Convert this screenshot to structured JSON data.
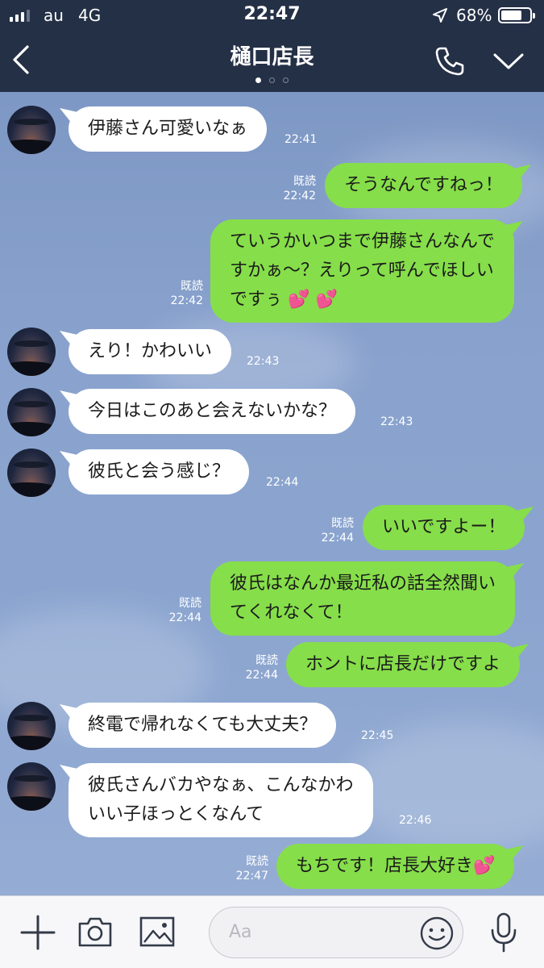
{
  "status_bar": {
    "carrier": "au",
    "network": "4G",
    "time": "22:47",
    "battery_percent": "68%",
    "battery_level": 0.68,
    "signal_bars": 3
  },
  "header": {
    "title": "樋口店長",
    "page_count": 3,
    "active_page": 1,
    "icons": [
      "back-chevron-icon",
      "phone-icon",
      "chevron-down-icon"
    ]
  },
  "messages": [
    {
      "side": "in",
      "lines": [
        "伊藤さん可愛いなぁ"
      ],
      "time": "22:41"
    },
    {
      "side": "out",
      "lines": [
        "そうなんですねっ！"
      ],
      "read": "既読",
      "time": "22:42"
    },
    {
      "side": "out",
      "lines": [
        "ていうかいつまで伊藤さんなんで",
        "すかぁ〜？えりって呼んでほしい",
        "ですぅ"
      ],
      "emoji": "💕 💕",
      "read": "既読",
      "time": "22:42"
    },
    {
      "side": "in",
      "lines": [
        "えり！かわいい"
      ],
      "time": "22:43"
    },
    {
      "side": "in",
      "lines": [
        "今日はこのあと会えないかな？"
      ],
      "time": "22:43"
    },
    {
      "side": "in",
      "lines": [
        "彼氏と会う感じ？"
      ],
      "time": "22:44"
    },
    {
      "side": "out",
      "lines": [
        "いいですよー！"
      ],
      "read": "既読",
      "time": "22:44"
    },
    {
      "side": "out",
      "lines": [
        "彼氏はなんか最近私の話全然聞い",
        "てくれなくて！"
      ],
      "read": "既読",
      "time": "22:44"
    },
    {
      "side": "out",
      "lines": [
        "ホントに店長だけですよ"
      ],
      "read": "既読",
      "time": "22:44"
    },
    {
      "side": "in",
      "lines": [
        "終電で帰れなくても大丈夫？"
      ],
      "time": "22:45"
    },
    {
      "side": "in",
      "lines": [
        "彼氏さんバカやなぁ、こんなかわ",
        "いい子ほっとくなんて"
      ],
      "time": "22:46"
    },
    {
      "side": "out",
      "lines": [
        "もちです！店長大好き"
      ],
      "emoji": "💕",
      "read": "既読",
      "time": "22:47"
    }
  ],
  "input_bar": {
    "placeholder": "Aa",
    "icons": [
      "plus-icon",
      "camera-icon",
      "image-icon",
      "smiley-icon",
      "microphone-icon"
    ]
  },
  "colors": {
    "header_bg": "#243046",
    "outgoing_bubble": "#86de4a",
    "incoming_bubble": "#ffffff",
    "chat_bg": "#8aa3ce"
  }
}
